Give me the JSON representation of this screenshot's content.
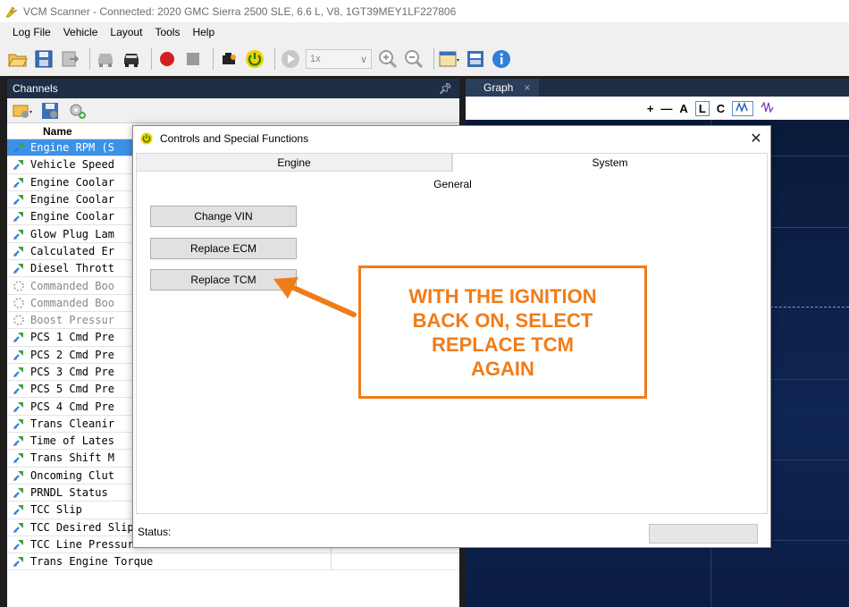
{
  "window": {
    "title": "VCM Scanner - Connected: 2020 GMC Sierra 2500 SLE, 6.6 L, V8, 1GT39MEY1LF227806"
  },
  "menu": [
    "Log File",
    "Vehicle",
    "Layout",
    "Tools",
    "Help"
  ],
  "toolbar": {
    "speed_value": "1x",
    "icons": [
      "open-folder-icon",
      "save-icon",
      "export-icon",
      "vehicle-icon",
      "vehicle-connect-icon",
      "record-icon",
      "stop-icon",
      "engine-icon",
      "power-icon",
      "play-icon",
      "zoom-in-icon",
      "zoom-out-icon",
      "layout-icon",
      "table-icon",
      "info-icon"
    ]
  },
  "channels": {
    "title": "Channels",
    "pin_glyph": "↕",
    "column_name": "Name",
    "rows": [
      {
        "name": "Engine RPM (S",
        "state": "selected"
      },
      {
        "name": "Vehicle Speed",
        "state": "normal"
      },
      {
        "name": "Engine Coolar",
        "state": "normal"
      },
      {
        "name": "Engine Coolar",
        "state": "normal"
      },
      {
        "name": "Engine Coolar",
        "state": "normal"
      },
      {
        "name": "Glow Plug Lam",
        "state": "normal"
      },
      {
        "name": "Calculated Er",
        "state": "normal"
      },
      {
        "name": "Diesel Thrott",
        "state": "normal"
      },
      {
        "name": "Commanded Boo",
        "state": "inactive"
      },
      {
        "name": "Commanded Boo",
        "state": "inactive"
      },
      {
        "name": "Boost Pressur",
        "state": "inactive"
      },
      {
        "name": "PCS 1 Cmd Pre",
        "state": "normal"
      },
      {
        "name": "PCS 2 Cmd Pre",
        "state": "normal"
      },
      {
        "name": "PCS 3 Cmd Pre",
        "state": "normal"
      },
      {
        "name": "PCS 5 Cmd Pre",
        "state": "normal"
      },
      {
        "name": "PCS 4 Cmd Pre",
        "state": "normal"
      },
      {
        "name": "Trans Cleanir",
        "state": "normal"
      },
      {
        "name": "Time of Lates",
        "state": "normal"
      },
      {
        "name": "Trans Shift M",
        "state": "normal"
      },
      {
        "name": "Oncoming Clut",
        "state": "normal"
      },
      {
        "name": "PRNDL Status",
        "state": "normal"
      },
      {
        "name": "TCC Slip",
        "state": "normal"
      },
      {
        "name": "TCC Desired Slip",
        "state": "normal"
      },
      {
        "name": "TCC Line Pressure",
        "state": "normal"
      },
      {
        "name": "Trans Engine Torque",
        "state": "normal"
      }
    ]
  },
  "graph": {
    "tab_label": "Graph",
    "tab_close": "×",
    "tools": [
      "+",
      "—",
      "A",
      "L",
      "C"
    ]
  },
  "dialog": {
    "title": "Controls and Special Functions",
    "close_glyph": "✕",
    "tabs": [
      "Engine",
      "System"
    ],
    "active_tab": "System",
    "group_title": "General",
    "buttons": [
      "Change VIN",
      "Replace ECM",
      "Replace TCM"
    ],
    "status_label": "Status:"
  },
  "callout": {
    "lines": [
      "WITH THE IGNITION",
      "BACK ON, SELECT",
      "REPLACE TCM",
      "AGAIN"
    ],
    "color": "#f07c19"
  }
}
